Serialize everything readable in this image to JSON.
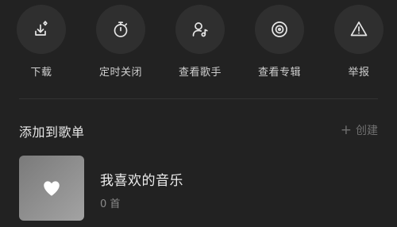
{
  "actions": [
    {
      "label": "下载",
      "icon": "download-icon"
    },
    {
      "label": "定时关闭",
      "icon": "timer-icon"
    },
    {
      "label": "查看歌手",
      "icon": "singer-icon"
    },
    {
      "label": "查看专辑",
      "icon": "album-icon"
    },
    {
      "label": "举报",
      "icon": "report-icon"
    }
  ],
  "section": {
    "title": "添加到歌单",
    "create_icon": "plus-icon",
    "create_label": "创建"
  },
  "playlists": [
    {
      "name": "我喜欢的音乐",
      "count": "0 首",
      "icon": "heart-icon"
    }
  ],
  "colors": {
    "background": "#222222",
    "circle": "#2f2f2f",
    "icon": "#e6e6e6",
    "muted": "#6f6f6f"
  }
}
